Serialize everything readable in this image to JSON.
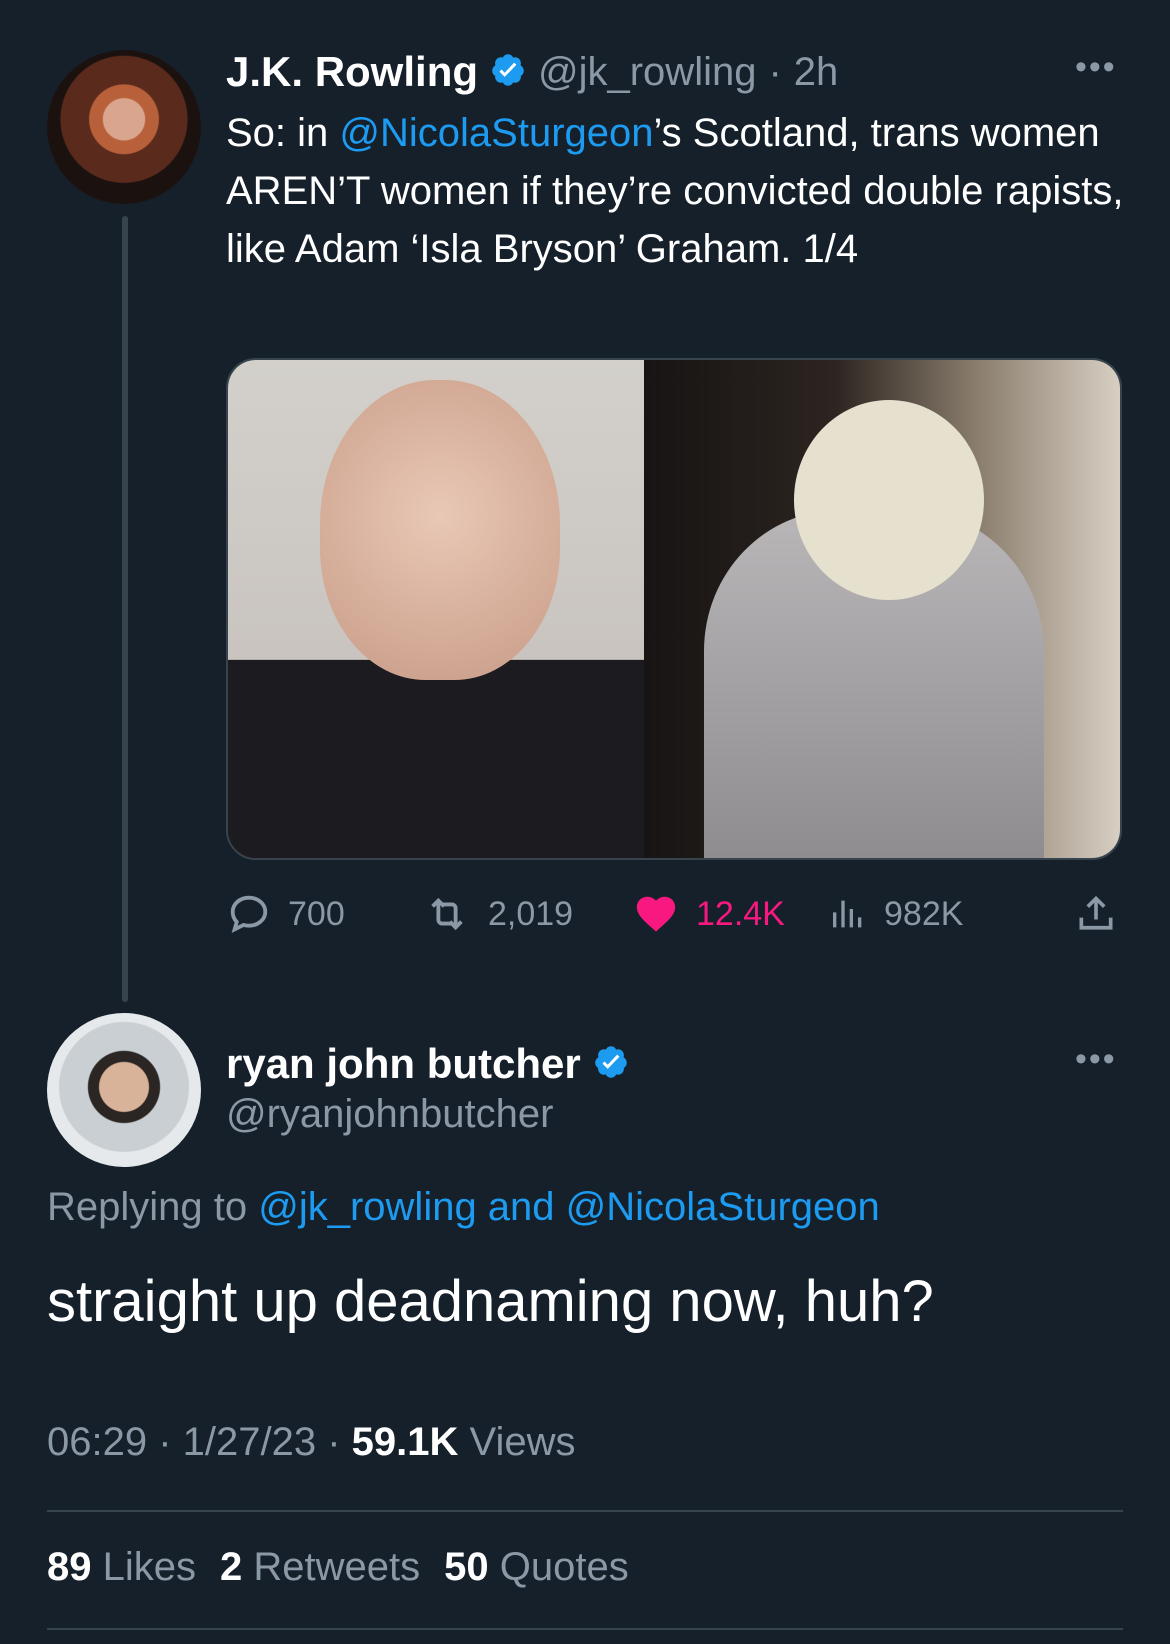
{
  "original_tweet": {
    "display_name": "J.K. Rowling",
    "handle": "@jk_rowling",
    "separator": "·",
    "age": "2h",
    "more_label": "•••",
    "text_parts": [
      "So: in ",
      "@NicolaSturgeon",
      "’s Scotland, trans women AREN’T women if they’re convicted double rapists, like Adam ‘Isla Bryson’ Graham. 1/4"
    ],
    "actions": {
      "replies": "700",
      "retweets": "2,019",
      "likes": "12.4K",
      "views": "982K"
    }
  },
  "reply_tweet": {
    "display_name": "ryan john butcher",
    "handle": "@ryanjohnbutcher",
    "more_label": "•••",
    "replying_prefix": "Replying to ",
    "replying_to": "@jk_rowling and @NicolaSturgeon",
    "text": "straight up deadnaming now, huh?",
    "time": "06:29",
    "date": "1/27/23",
    "sep": " · ",
    "views_count": "59.1K",
    "views_label": " Views",
    "likes_count": "89",
    "likes_label": " Likes",
    "retweets_count": "2",
    "retweets_label": " Retweets",
    "quotes_count": "50",
    "quotes_label": " Quotes"
  },
  "colors": {
    "background": "#15202b",
    "link": "#1d9bf0",
    "muted": "#8b98a5",
    "like": "#f91880"
  },
  "icons": [
    "verified-badge-icon",
    "reply-icon",
    "retweet-icon",
    "heart-icon",
    "views-icon",
    "share-icon"
  ]
}
